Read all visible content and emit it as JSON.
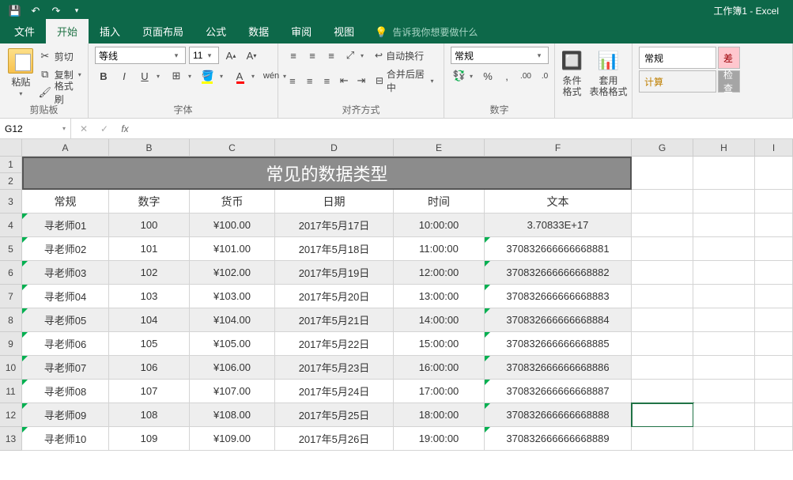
{
  "titlebar": {
    "title": "工作簿1 - Excel"
  },
  "tabs": {
    "file": "文件",
    "home": "开始",
    "insert": "插入",
    "layout": "页面布局",
    "formula": "公式",
    "data": "数据",
    "review": "审阅",
    "view": "视图",
    "tellme": "告诉我你想要做什么"
  },
  "ribbon": {
    "clipboard": {
      "label": "剪贴板",
      "paste": "粘贴",
      "cut": "剪切",
      "copy": "复制",
      "painter": "格式刷"
    },
    "font": {
      "label": "字体",
      "name": "等线",
      "size": "11"
    },
    "align": {
      "label": "对齐方式",
      "wrap": "自动换行",
      "merge": "合并后居中"
    },
    "number": {
      "label": "数字",
      "format": "常规"
    },
    "styles": {
      "cond": "条件格式",
      "table": "套用\n表格格式"
    },
    "cellstyles": {
      "normal": "常规",
      "calc": "计算",
      "bad": "差",
      "check": "检查"
    }
  },
  "namebox": "G12",
  "cols": [
    "A",
    "B",
    "C",
    "D",
    "E",
    "F",
    "G",
    "H",
    "I"
  ],
  "rows": [
    "1",
    "2",
    "3",
    "4",
    "5",
    "6",
    "7",
    "8",
    "9",
    "10",
    "11",
    "12",
    "13"
  ],
  "sheet": {
    "title": "常见的数据类型",
    "headers": [
      "常规",
      "数字",
      "货币",
      "日期",
      "时间",
      "文本"
    ],
    "data": [
      [
        "寻老师01",
        "100",
        "¥100.00",
        "2017年5月17日",
        "10:00:00",
        "3.70833E+17"
      ],
      [
        "寻老师02",
        "101",
        "¥101.00",
        "2017年5月18日",
        "11:00:00",
        "370832666666668881"
      ],
      [
        "寻老师03",
        "102",
        "¥102.00",
        "2017年5月19日",
        "12:00:00",
        "370832666666668882"
      ],
      [
        "寻老师04",
        "103",
        "¥103.00",
        "2017年5月20日",
        "13:00:00",
        "370832666666668883"
      ],
      [
        "寻老师05",
        "104",
        "¥104.00",
        "2017年5月21日",
        "14:00:00",
        "370832666666668884"
      ],
      [
        "寻老师06",
        "105",
        "¥105.00",
        "2017年5月22日",
        "15:00:00",
        "370832666666668885"
      ],
      [
        "寻老师07",
        "106",
        "¥106.00",
        "2017年5月23日",
        "16:00:00",
        "370832666666668886"
      ],
      [
        "寻老师08",
        "107",
        "¥107.00",
        "2017年5月24日",
        "17:00:00",
        "370832666666668887"
      ],
      [
        "寻老师09",
        "108",
        "¥108.00",
        "2017年5月25日",
        "18:00:00",
        "370832666666668888"
      ],
      [
        "寻老师10",
        "109",
        "¥109.00",
        "2017年5月26日",
        "19:00:00",
        "370832666666668889"
      ]
    ]
  },
  "chart_data": {
    "type": "table",
    "title": "常见的数据类型",
    "columns": [
      "常规",
      "数字",
      "货币",
      "日期",
      "时间",
      "文本"
    ],
    "rows": [
      [
        "寻老师01",
        100,
        "¥100.00",
        "2017年5月17日",
        "10:00:00",
        "3.70833E+17"
      ],
      [
        "寻老师02",
        101,
        "¥101.00",
        "2017年5月18日",
        "11:00:00",
        "370832666666668881"
      ],
      [
        "寻老师03",
        102,
        "¥102.00",
        "2017年5月19日",
        "12:00:00",
        "370832666666668882"
      ],
      [
        "寻老师04",
        103,
        "¥103.00",
        "2017年5月20日",
        "13:00:00",
        "370832666666668883"
      ],
      [
        "寻老师05",
        104,
        "¥104.00",
        "2017年5月21日",
        "14:00:00",
        "370832666666668884"
      ],
      [
        "寻老师06",
        105,
        "¥105.00",
        "2017年5月22日",
        "15:00:00",
        "370832666666668885"
      ],
      [
        "寻老师07",
        106,
        "¥106.00",
        "2017年5月23日",
        "16:00:00",
        "370832666666668886"
      ],
      [
        "寻老师08",
        107,
        "¥107.00",
        "2017年5月24日",
        "17:00:00",
        "370832666666668887"
      ],
      [
        "寻老师09",
        108,
        "¥108.00",
        "2017年5月25日",
        "18:00:00",
        "370832666666668888"
      ],
      [
        "寻老师10",
        109,
        "¥109.00",
        "2017年5月26日",
        "19:00:00",
        "370832666666668889"
      ]
    ]
  }
}
